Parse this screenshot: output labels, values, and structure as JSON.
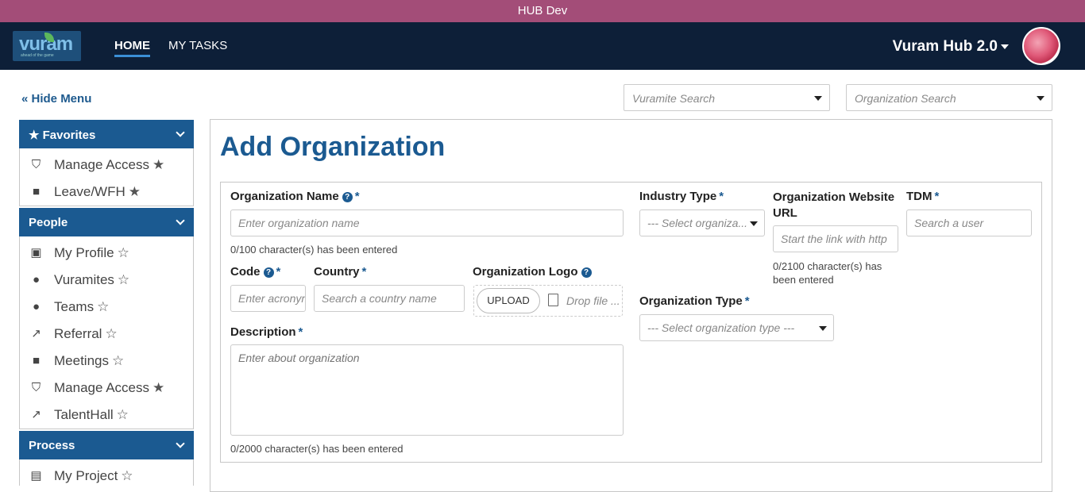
{
  "window": {
    "title": "HUB Dev"
  },
  "topnav": {
    "logo_text": "vuram",
    "logo_sub": "ahead of the game",
    "tabs": [
      {
        "label": "HOME",
        "active": true
      },
      {
        "label": "MY TASKS",
        "active": false
      }
    ],
    "app_name": "Vuram Hub 2.0"
  },
  "hide_menu": "Hide Menu",
  "search": {
    "vuramite": "Vuramite Search",
    "organization": "Organization Search"
  },
  "sidebar": {
    "favorites": {
      "title": "Favorites",
      "items": [
        {
          "label": "Manage Access",
          "icon": "shield-icon",
          "starred": true
        },
        {
          "label": "Leave/WFH",
          "icon": "briefcase-icon",
          "starred": true
        }
      ]
    },
    "people": {
      "title": "People",
      "items": [
        {
          "label": "My Profile",
          "icon": "profile-icon",
          "starred": false
        },
        {
          "label": "Vuramites",
          "icon": "users-icon",
          "starred": false
        },
        {
          "label": "Teams",
          "icon": "users-icon",
          "starred": false
        },
        {
          "label": "Referral",
          "icon": "share-icon",
          "starred": false
        },
        {
          "label": "Meetings",
          "icon": "video-icon",
          "starred": false
        },
        {
          "label": "Manage Access",
          "icon": "shield-icon",
          "starred": true
        },
        {
          "label": "TalentHall",
          "icon": "share-icon",
          "starred": false
        }
      ]
    },
    "process": {
      "title": "Process",
      "items": [
        {
          "label": "My Project",
          "icon": "file-excel-icon",
          "starred": false
        }
      ]
    }
  },
  "page": {
    "title": "Add Organization"
  },
  "form": {
    "org_name": {
      "label": "Organization Name",
      "placeholder": "Enter organization name",
      "helper": "0/100 character(s) has been entered"
    },
    "industry_type": {
      "label": "Industry Type",
      "placeholder": "--- Select organiza..."
    },
    "website": {
      "label": "Organization Website URL",
      "placeholder": "Start the link with http",
      "helper": "0/2100 character(s) has been entered"
    },
    "tdm": {
      "label": "TDM",
      "placeholder": "Search a user"
    },
    "code": {
      "label": "Code",
      "placeholder": "Enter acronym"
    },
    "country": {
      "label": "Country",
      "placeholder": "Search a country name"
    },
    "logo": {
      "label": "Organization Logo",
      "upload_label": "UPLOAD",
      "drop_text": "Drop file ..."
    },
    "org_type": {
      "label": "Organization Type",
      "placeholder": "--- Select organization type ---"
    },
    "description": {
      "label": "Description",
      "placeholder": "Enter about organization",
      "helper": "0/2000 character(s) has been entered"
    }
  }
}
